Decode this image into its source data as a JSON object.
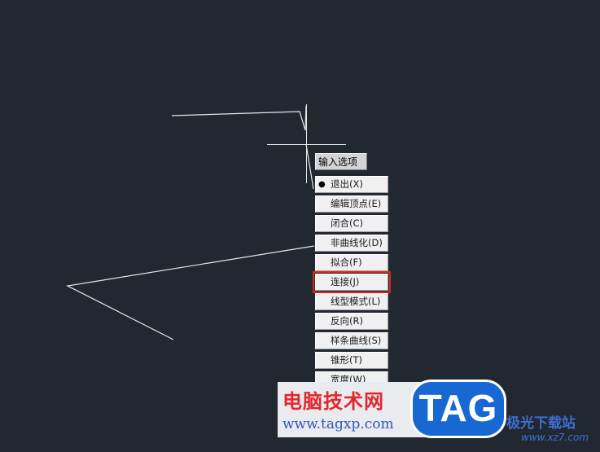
{
  "prompt": {
    "label": "输入选项"
  },
  "menu": {
    "items": [
      {
        "label": "退出(X)",
        "selected": true,
        "highlighted": false
      },
      {
        "label": "编辑顶点(E)",
        "selected": false,
        "highlighted": false
      },
      {
        "label": "闭合(C)",
        "selected": false,
        "highlighted": false
      },
      {
        "label": "非曲线化(D)",
        "selected": false,
        "highlighted": false
      },
      {
        "label": "拟合(F)",
        "selected": false,
        "highlighted": false
      },
      {
        "label": "连接(J)",
        "selected": false,
        "highlighted": true
      },
      {
        "label": "线型模式(L)",
        "selected": false,
        "highlighted": false
      },
      {
        "label": "反向(R)",
        "selected": false,
        "highlighted": false
      },
      {
        "label": "样条曲线(S)",
        "selected": false,
        "highlighted": false
      },
      {
        "label": "锥形(T)",
        "selected": false,
        "highlighted": false
      },
      {
        "label": "宽度(W)",
        "selected": false,
        "highlighted": false
      }
    ]
  },
  "watermark": {
    "site_name": "电脑技术网",
    "site_url": "www.tagxp.com",
    "tag_text": "TAG",
    "partner_name": "极光下载站",
    "partner_url": "www.xz7.com"
  },
  "colors": {
    "background": "#212830",
    "line": "#e8e8e8",
    "highlight_border": "#e0261d"
  }
}
